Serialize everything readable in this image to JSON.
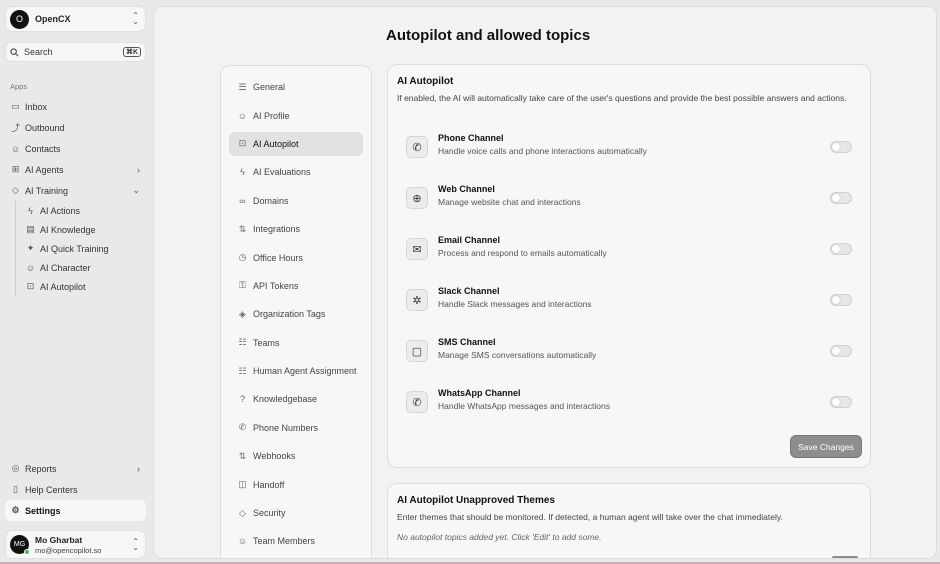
{
  "org": {
    "initial": "O",
    "name": "OpenCX"
  },
  "search": {
    "label": "Search",
    "shortcut": "⌘K"
  },
  "sidebar": {
    "section_label": "Apps",
    "items": [
      {
        "label": "Inbox",
        "icon": "inbox-icon",
        "glyph": "▭"
      },
      {
        "label": "Outbound",
        "icon": "outbound-icon",
        "glyph": "⤴"
      },
      {
        "label": "Contacts",
        "icon": "contacts-icon",
        "glyph": "☺"
      },
      {
        "label": "AI Agents",
        "icon": "ai-agents-icon",
        "glyph": "⊞"
      },
      {
        "label": "AI Training",
        "icon": "ai-training-icon",
        "glyph": "◇"
      }
    ],
    "training_sub": [
      {
        "label": "AI Actions",
        "glyph": "ϟ"
      },
      {
        "label": "AI Knowledge",
        "glyph": "▤"
      },
      {
        "label": "AI Quick Training",
        "glyph": "✦"
      },
      {
        "label": "AI Character",
        "glyph": "☺"
      },
      {
        "label": "AI Autopilot",
        "glyph": "⊡"
      }
    ],
    "bottom": [
      {
        "label": "Reports",
        "glyph": "◎"
      },
      {
        "label": "Help Centers",
        "glyph": "▯"
      },
      {
        "label": "Settings",
        "glyph": "⚙"
      }
    ]
  },
  "user": {
    "initials": "MG",
    "name": "Mo Gharbat",
    "email": "mo@opencopilot.so"
  },
  "page": {
    "title": "Autopilot and allowed topics"
  },
  "settings_nav": [
    {
      "label": "General",
      "glyph": "☰"
    },
    {
      "label": "AI Profile",
      "glyph": "☺"
    },
    {
      "label": "AI Autopilot",
      "glyph": "⊡"
    },
    {
      "label": "AI Evaluations",
      "glyph": "ϟ"
    },
    {
      "label": "Domains",
      "glyph": "∞"
    },
    {
      "label": "Integrations",
      "glyph": "⇅"
    },
    {
      "label": "Office Hours",
      "glyph": "◷"
    },
    {
      "label": "API Tokens",
      "glyph": "⚿"
    },
    {
      "label": "Organization Tags",
      "glyph": "◈"
    },
    {
      "label": "Teams",
      "glyph": "☷"
    },
    {
      "label": "Human Agent Assignment",
      "glyph": "☷"
    },
    {
      "label": "Knowledgebase",
      "glyph": "?"
    },
    {
      "label": "Phone Numbers",
      "glyph": "✆"
    },
    {
      "label": "Webhooks",
      "glyph": "⇅"
    },
    {
      "label": "Handoff",
      "glyph": "◫"
    },
    {
      "label": "Security",
      "glyph": "◇"
    },
    {
      "label": "Team Members",
      "glyph": "☺"
    }
  ],
  "autopilot": {
    "title": "AI Autopilot",
    "description": "If enabled, the AI will automatically take care of the user's questions and provide the best possible answers and actions.",
    "save_label": "Save Changes",
    "channels": [
      {
        "name": "Phone Channel",
        "description": "Handle voice calls and phone interactions automatically",
        "icon": "phone-icon",
        "glyph": "✆",
        "enabled": false
      },
      {
        "name": "Web Channel",
        "description": "Manage website chat and interactions",
        "icon": "globe-icon",
        "glyph": "⊕",
        "enabled": false
      },
      {
        "name": "Email Channel",
        "description": "Process and respond to emails automatically",
        "icon": "mail-icon",
        "glyph": "✉",
        "enabled": false
      },
      {
        "name": "Slack Channel",
        "description": "Handle Slack messages and interactions",
        "icon": "slack-icon",
        "glyph": "✲",
        "enabled": false
      },
      {
        "name": "SMS Channel",
        "description": "Manage SMS conversations automatically",
        "icon": "message-icon",
        "glyph": "▢",
        "enabled": false
      },
      {
        "name": "WhatsApp Channel",
        "description": "Handle WhatsApp messages and interactions",
        "icon": "whatsapp-icon",
        "glyph": "✆",
        "enabled": false
      }
    ]
  },
  "unapproved": {
    "title": "AI Autopilot Unapproved Themes",
    "description": "Enter themes that should be monitored. If detected, a human agent will take over the chat immediately.",
    "empty_note": "No autopilot topics added yet. Click 'Edit' to add some."
  }
}
